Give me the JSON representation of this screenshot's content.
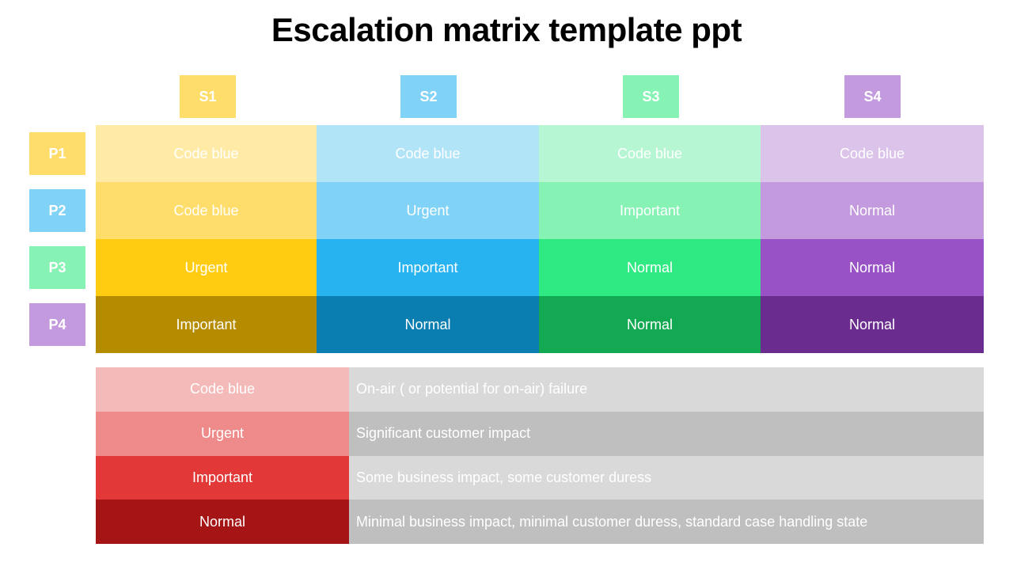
{
  "title": "Escalation matrix template ppt",
  "severity_headers": [
    {
      "label": "S1",
      "color": "#ffdd6b"
    },
    {
      "label": "S2",
      "color": "#80d3f6"
    },
    {
      "label": "S3",
      "color": "#86f2b4"
    },
    {
      "label": "S4",
      "color": "#c39add"
    }
  ],
  "priority_headers": [
    {
      "label": "P1",
      "color": "#ffdd6b"
    },
    {
      "label": "P2",
      "color": "#80d3f6"
    },
    {
      "label": "P3",
      "color": "#86f2b4"
    },
    {
      "label": "P4",
      "color": "#c39add"
    }
  ],
  "matrix": {
    "rows": [
      {
        "priority": "P1",
        "cells": [
          {
            "label": "Code blue",
            "color": "#ffeba6"
          },
          {
            "label": "Code blue",
            "color": "#b2e4f8"
          },
          {
            "label": "Code blue",
            "color": "#b6f6d2"
          },
          {
            "label": "Code blue",
            "color": "#dbc3ea"
          }
        ]
      },
      {
        "priority": "P2",
        "cells": [
          {
            "label": "Code blue",
            "color": "#ffdd6b"
          },
          {
            "label": "Urgent",
            "color": "#80d3f6"
          },
          {
            "label": "Important",
            "color": "#86f2b4"
          },
          {
            "label": "Normal",
            "color": "#c39add"
          }
        ]
      },
      {
        "priority": "P3",
        "cells": [
          {
            "label": "Urgent",
            "color": "#ffcc12"
          },
          {
            "label": "Important",
            "color": "#26b3f0"
          },
          {
            "label": "Normal",
            "color": "#2fe982"
          },
          {
            "label": "Normal",
            "color": "#9852c6"
          }
        ]
      },
      {
        "priority": "P4",
        "cells": [
          {
            "label": "Important",
            "color": "#b58b00"
          },
          {
            "label": "Normal",
            "color": "#0b7eb1"
          },
          {
            "label": "Normal",
            "color": "#13a953"
          },
          {
            "label": "Normal",
            "color": "#6a2d8f"
          }
        ]
      }
    ]
  },
  "legend": [
    {
      "level": "Code blue",
      "color": "#f4b9b9",
      "description": "On-air ( or potential for on-air) failure"
    },
    {
      "level": "Urgent",
      "color": "#ef8a8a",
      "description": "Significant customer impact"
    },
    {
      "level": "Important",
      "color": "#e33838",
      "description": "Some business impact, some customer duress"
    },
    {
      "level": "Normal",
      "color": "#a61515",
      "description": "Minimal business impact, minimal customer duress, standard case handling state"
    }
  ]
}
